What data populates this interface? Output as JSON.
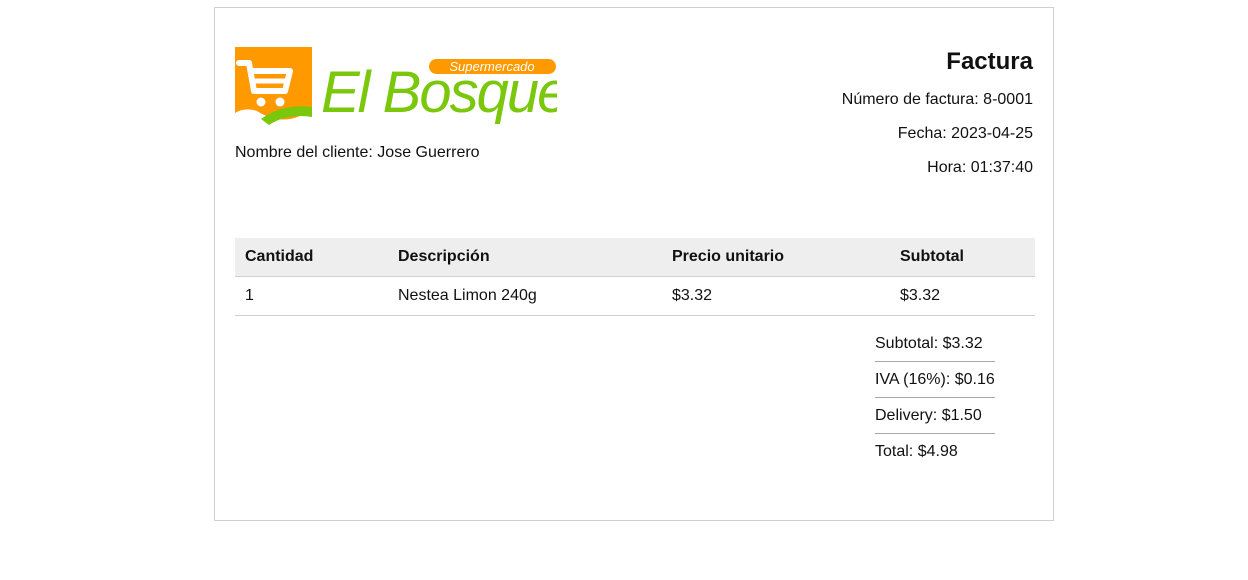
{
  "logo": {
    "brand": "El Bosque",
    "tagline": "Supermercado",
    "colors": {
      "orange": "#ff9900",
      "green": "#7ac70c",
      "white": "#ffffff"
    }
  },
  "customer": {
    "label": "Nombre del cliente:",
    "name": "Jose Guerrero"
  },
  "invoice": {
    "title": "Factura",
    "number_label": "Número de factura:",
    "number": "8-0001",
    "date_label": "Fecha:",
    "date": "2023-04-25",
    "time_label": "Hora:",
    "time": "01:37:40"
  },
  "table": {
    "headers": [
      "Cantidad",
      "Descripción",
      "Precio unitario",
      "Subtotal"
    ],
    "rows": [
      [
        "1",
        "Nestea Limon 240g",
        "$3.32",
        "$3.32"
      ]
    ]
  },
  "totals": {
    "subtotal_label": "Subtotal:",
    "subtotal": "$3.32",
    "iva_label": "IVA (16%):",
    "iva": "$0.16",
    "delivery_label": "Delivery:",
    "delivery": "$1.50",
    "total_label": "Total:",
    "total": "$4.98"
  },
  "colors": {
    "border": "#cfcfcf",
    "header_bg": "#eeeeee",
    "text": "#111111"
  }
}
